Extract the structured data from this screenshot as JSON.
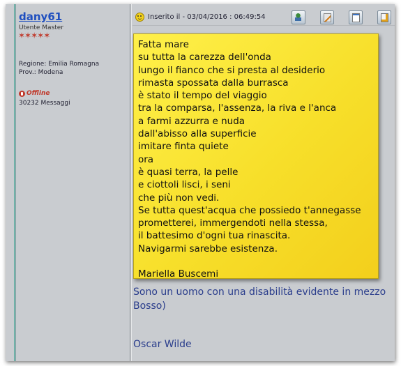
{
  "profile": {
    "username": "dany61",
    "rank": "Utente Master",
    "stars": "✶✶✶✶✶",
    "region_line": "Regione: Emilia Romagna",
    "province_line": "Prov.: Modena",
    "status": "Offline",
    "message_count": "30232 Messaggi"
  },
  "post": {
    "inserted_label": "Inserito il - 03/04/2016 :  06:49:54",
    "poem_lines": [
      "Fatta mare",
      "su tutta la carezza dell'onda",
      "lungo il fianco che si presta al desiderio",
      "rimasta spossata dalla burrasca",
      "è stato il tempo del viaggio",
      "tra la comparsa, l'assenza, la riva e l'anca",
      "a farmi azzurra e nuda",
      "dall'abisso alla superficie",
      "imitare finta quiete",
      "ora",
      "è quasi terra, la pelle",
      "e ciottoli lisci, i seni",
      "che più non vedi.",
      "Se tutta quest'acqua che possiedo t'annegasse",
      "prometterei, immergendoti nella stessa,",
      "il battesimo d'ogni tua rinascita.",
      "Navigarmi sarebbe esistenza.",
      "",
      "Mariella Buscemi"
    ],
    "signature_line1": "Sono un uomo con una disabilità evidente in mezzo",
    "signature_line2": "Bosso)",
    "signature_author": "Oscar Wilde"
  },
  "toolbar": {
    "icons": [
      "profile-icon",
      "edit-icon",
      "document-icon",
      "quote-icon",
      "delete-icon"
    ]
  },
  "colors": {
    "note_background": "#f7df2a",
    "username_link": "#1f4fbf",
    "offline": "#c0392b",
    "signature_text": "#2a3d8c"
  }
}
